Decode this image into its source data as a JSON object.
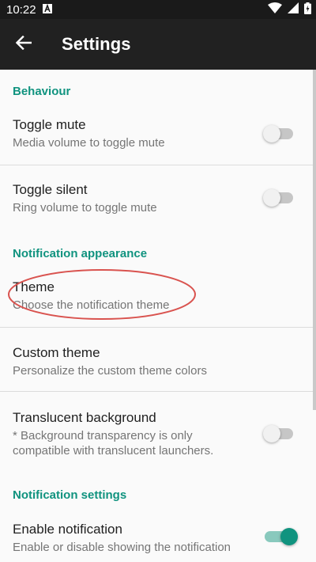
{
  "status_bar": {
    "time": "10:22",
    "left_icon": "a-notification-icon",
    "right_icons": [
      "wifi-icon",
      "signal-icon",
      "battery-icon"
    ]
  },
  "app_bar": {
    "title": "Settings",
    "back_icon": "arrow-back-icon"
  },
  "colors": {
    "accent": "#10937f",
    "status_bar": "#1a1a1a",
    "app_bar": "#212121",
    "background": "#fafafa",
    "annotation": "#d9534f"
  },
  "sections": {
    "behaviour": {
      "title": "Behaviour",
      "items": [
        {
          "title": "Toggle mute",
          "summary": "Media volume to toggle mute",
          "switch_on": false
        },
        {
          "title": "Toggle silent",
          "summary": "Ring volume to toggle mute",
          "switch_on": false
        }
      ]
    },
    "appearance": {
      "title": "Notification appearance",
      "items": [
        {
          "title": "Theme",
          "summary": "Choose the notification theme"
        },
        {
          "title": "Custom theme",
          "summary": "Personalize the custom theme colors"
        },
        {
          "title": "Translucent background",
          "summary_line1": "* Background transparency is only",
          "summary_line2": "compatible with translucent launchers.",
          "switch_on": false
        }
      ]
    },
    "notification_settings": {
      "title": "Notification settings",
      "items": [
        {
          "title": "Enable notification",
          "summary": "Enable or disable showing the notification",
          "switch_on": true
        }
      ]
    }
  }
}
